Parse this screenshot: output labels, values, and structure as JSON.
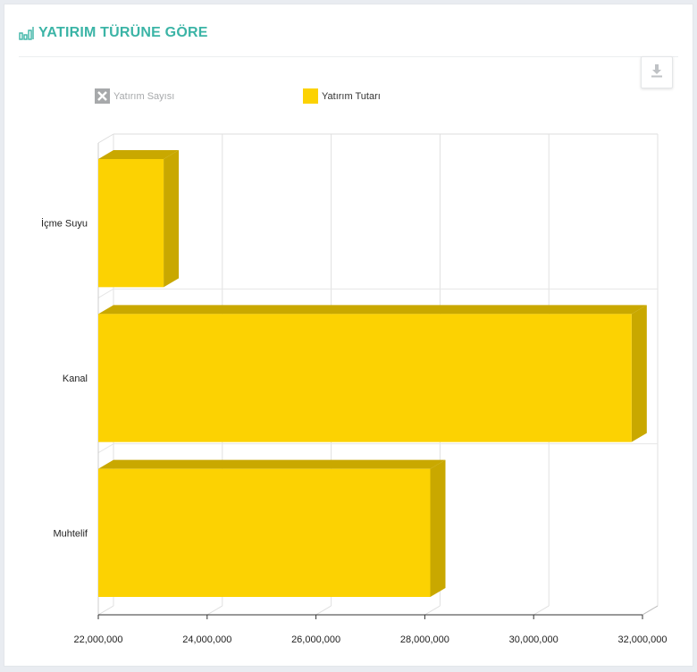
{
  "header": {
    "title": "YATIRIM TÜRÜNE GÖRE",
    "icon": "bar-chart-icon"
  },
  "toolbar": {
    "download_icon": "download-icon"
  },
  "legend": [
    {
      "label": "Yatırım Sayısı",
      "state": "disabled",
      "color": "#a7a9ab"
    },
    {
      "label": "Yatırım Tutarı",
      "state": "enabled",
      "color": "#fcd202"
    }
  ],
  "colors": {
    "accent": "#3bb4a6",
    "bar_front": "#fcd202",
    "bar_side": "#c9a800"
  },
  "chart_data": {
    "type": "bar",
    "orientation": "horizontal",
    "render": "3d",
    "categories": [
      "İçme Suyu",
      "Kanal",
      "Muhtelif"
    ],
    "series": [
      {
        "name": "Yatırım Tutarı",
        "values": [
          23200000,
          31800000,
          28100000
        ]
      }
    ],
    "xlim": [
      22000000,
      32000000
    ],
    "xticks": [
      "22,000,000",
      "24,000,000",
      "26,000,000",
      "28,000,000",
      "30,000,000",
      "32,000,000"
    ],
    "xtick_values": [
      22000000,
      24000000,
      26000000,
      28000000,
      30000000,
      32000000
    ],
    "grid": true,
    "legend_position": "top"
  }
}
